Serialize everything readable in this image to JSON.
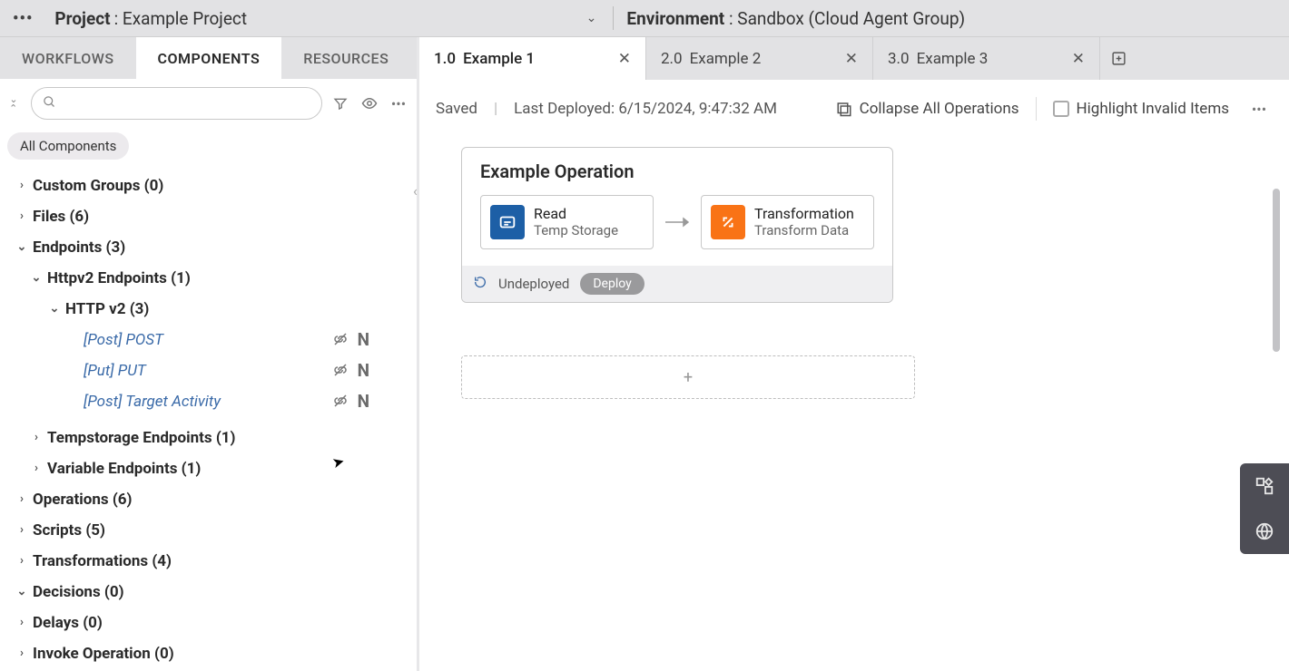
{
  "header": {
    "project_label": "Project",
    "project_name": ": Example Project",
    "environment_label": "Environment",
    "environment_name": ": Sandbox (Cloud Agent Group)"
  },
  "side_tabs": {
    "workflows": "WORKFLOWS",
    "components": "COMPONENTS",
    "resources": "RESOURCES"
  },
  "sidebar": {
    "search_placeholder": "",
    "chip_all": "All Components",
    "nodes": {
      "custom_groups": "Custom Groups (0)",
      "files": "Files (6)",
      "endpoints": "Endpoints (3)",
      "httpv2_endpoints": "Httpv2 Endpoints (1)",
      "http_v2": "HTTP v2 (3)",
      "leaf_post": "[Post] POST",
      "leaf_put": "[Put] PUT",
      "leaf_target": "[Post] Target Activity",
      "tempstorage": "Tempstorage Endpoints (1)",
      "variable": "Variable Endpoints (1)",
      "operations": "Operations (6)",
      "scripts": "Scripts (5)",
      "transformations": "Transformations (4)",
      "decisions": "Decisions (0)",
      "delays": "Delays (0)",
      "invoke": "Invoke Operation (0)",
      "badge_N": "N"
    }
  },
  "canvas_tabs": [
    {
      "num": "1.0",
      "label": "Example 1"
    },
    {
      "num": "2.0",
      "label": "Example 2"
    },
    {
      "num": "3.0",
      "label": "Example 3"
    }
  ],
  "action_bar": {
    "saved": "Saved",
    "divider": "|",
    "last_deployed": "Last Deployed: 6/15/2024, 9:47:32 AM",
    "collapse": "Collapse All Operations",
    "highlight": "Highlight Invalid Items"
  },
  "operation": {
    "title": "Example Operation",
    "a1_title": "Read",
    "a1_sub": "Temp Storage",
    "a2_title": "Transformation",
    "a2_sub": "Transform Data",
    "status": "Undeployed",
    "deploy": "Deploy"
  },
  "dropzone_plus": "+"
}
